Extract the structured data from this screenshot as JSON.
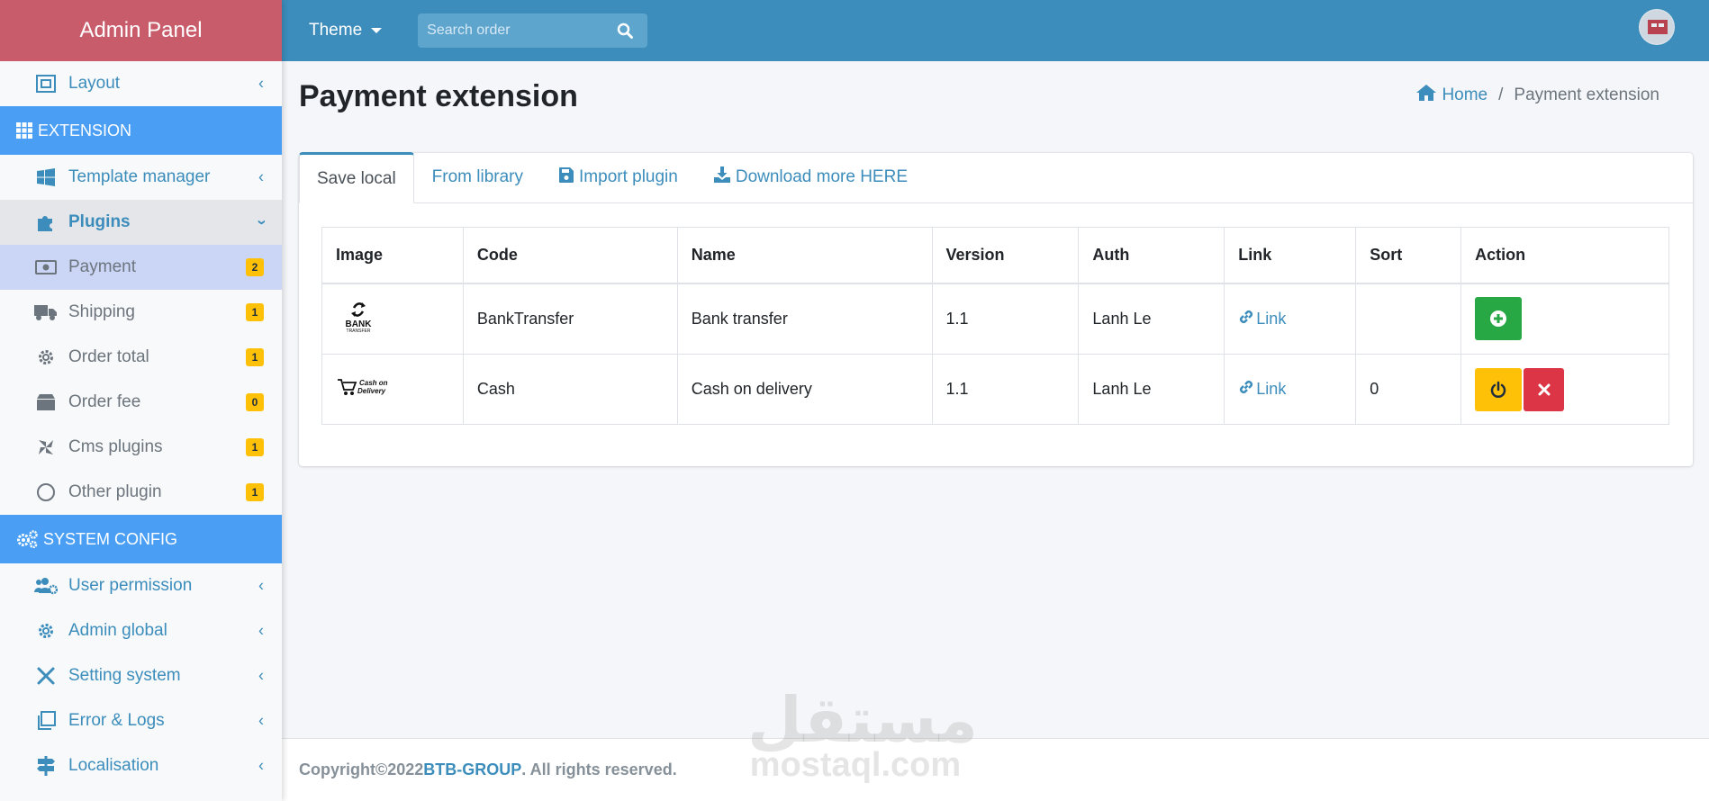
{
  "sidebar": {
    "brand": "Admin Panel",
    "layout_label": "Layout",
    "extension_header": "EXTENSION",
    "template_manager_label": "Template manager",
    "plugins_label": "Plugins",
    "items": [
      {
        "label": "Payment",
        "badge": "2"
      },
      {
        "label": "Shipping",
        "badge": "1"
      },
      {
        "label": "Order total",
        "badge": "1"
      },
      {
        "label": "Order fee",
        "badge": "0"
      },
      {
        "label": "Cms plugins",
        "badge": "1"
      },
      {
        "label": "Other plugin",
        "badge": "1"
      }
    ],
    "system_header": "SYSTEM CONFIG",
    "system_items": [
      {
        "label": "User permission"
      },
      {
        "label": "Admin global"
      },
      {
        "label": "Setting system"
      },
      {
        "label": "Error & Logs"
      },
      {
        "label": "Localisation"
      }
    ]
  },
  "topbar": {
    "theme_label": "Theme",
    "search_placeholder": "Search order"
  },
  "page": {
    "title": "Payment extension",
    "breadcrumb_home": "Home",
    "breadcrumb_sep": "/",
    "breadcrumb_current": "Payment extension"
  },
  "tabs": [
    {
      "label": "Save local"
    },
    {
      "label": "From library"
    },
    {
      "label": "Import plugin"
    },
    {
      "label": "Download more HERE"
    }
  ],
  "table": {
    "headers": [
      "Image",
      "Code",
      "Name",
      "Version",
      "Auth",
      "Link",
      "Sort",
      "Action"
    ],
    "rows": [
      {
        "image_text": "BANK TRANSFER",
        "code": "BankTransfer",
        "name": "Bank transfer",
        "version": "1.1",
        "auth": "Lanh Le",
        "link": "Link",
        "sort": ""
      },
      {
        "image_text": "Cash on Delivery",
        "code": "Cash",
        "name": "Cash on delivery",
        "version": "1.1",
        "auth": "Lanh Le",
        "link": "Link",
        "sort": "0"
      }
    ]
  },
  "footer": {
    "copyright": "Copyright©2022 ",
    "brand": "BTB-GROUP",
    "rights": ". All rights reserved."
  },
  "watermark": {
    "arabic": "مستقل",
    "latin": "mostaql.com"
  },
  "colors": {
    "brand_bg": "#c95c6b",
    "topbar": "#3c8dbc",
    "section_header": "#4a9ff5",
    "badge": "#ffc107",
    "install": "#28a745",
    "remove": "#dc3545"
  }
}
